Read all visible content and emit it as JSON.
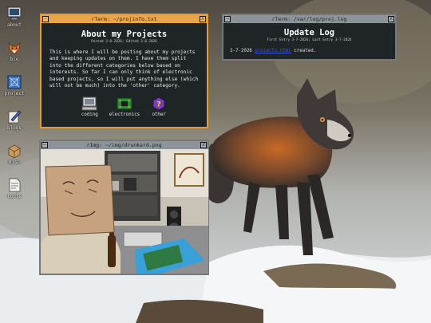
{
  "desktop_icons": [
    {
      "label": "about",
      "icon": "monitor-icon"
    },
    {
      "label": "bio",
      "icon": "fox-icon"
    },
    {
      "label": "project",
      "icon": "blueprint-icon"
    },
    {
      "label": "blogs",
      "icon": "pen-icon"
    },
    {
      "label": "misc",
      "icon": "box-icon"
    },
    {
      "label": "tools",
      "icon": "document-icon"
    }
  ],
  "about_window": {
    "title": "rTerm: ~/projinfo.txt",
    "heading": "About my Projects",
    "meta": "Posted 3-8-2026; Edited 3-8-2026",
    "body": "This is where I will be posting about my projects and keeping updates on them. I have them split into the different categories below based on interests. So far I can only think of electronic based projects, so I will put anything else (which will not be much) into the 'other' category.",
    "categories": [
      {
        "label": "coding",
        "icon": "computer-icon"
      },
      {
        "label": "electronics",
        "icon": "circuit-board-icon"
      },
      {
        "label": "other",
        "icon": "question-mark-icon"
      }
    ]
  },
  "log_window": {
    "title": "rTerm: /var/log/proj.log",
    "heading": "Update Log",
    "meta": "First Entry 3-7-2026; Last Entry 3-7-2026",
    "entry_date": "3-7-2026",
    "entry_link": "projects.html",
    "entry_suffix": "created."
  },
  "image_window": {
    "title": "rImg: ~/img/drunkard.png"
  },
  "window_controls": {
    "minimize": "–",
    "close": "x"
  },
  "colors": {
    "active_window": "#e39a3a",
    "inactive_window": "#73797b",
    "window_bg": "#1f2527",
    "link": "#3b57d6"
  }
}
